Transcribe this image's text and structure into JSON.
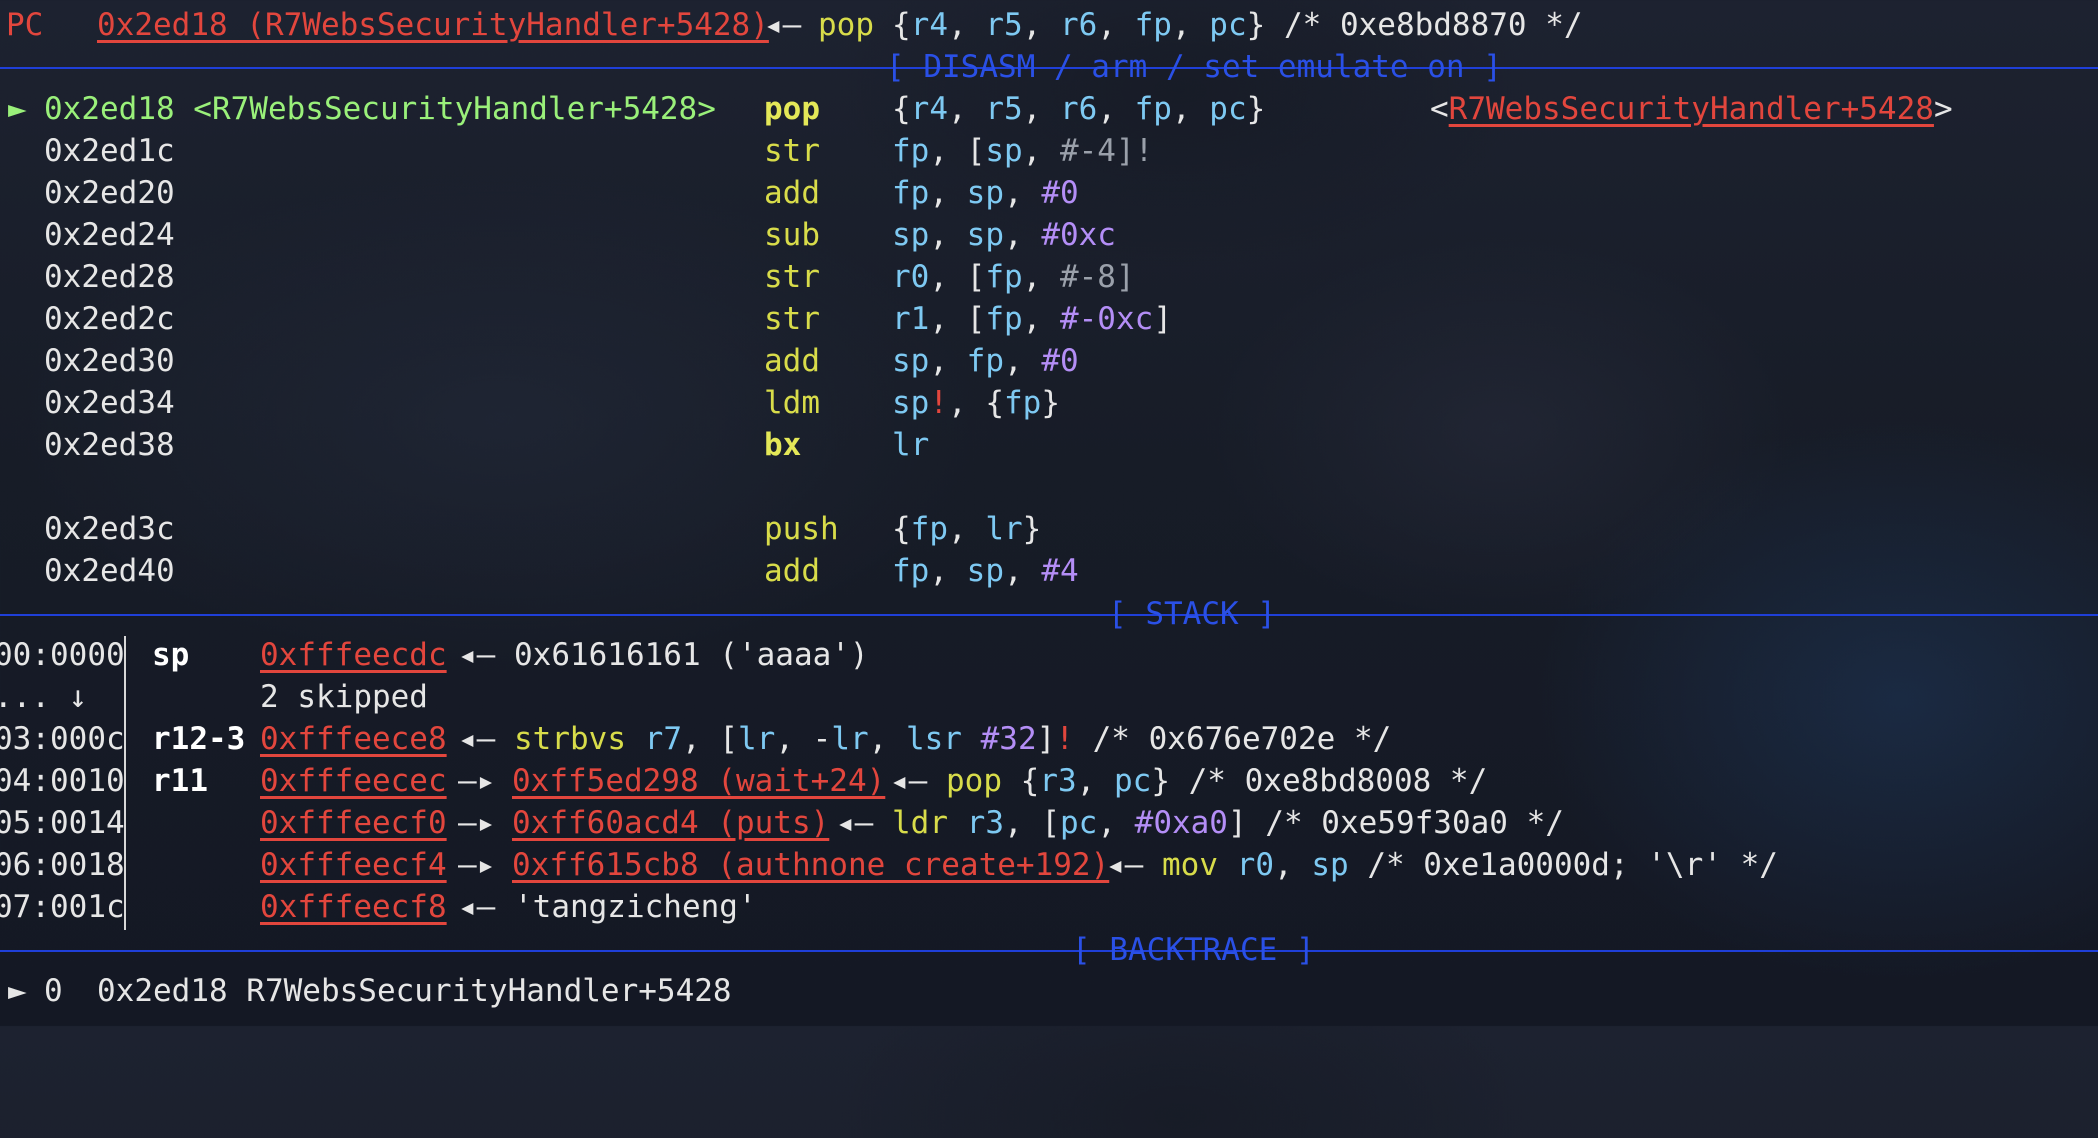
{
  "header": {
    "pc_label": "PC",
    "pc_value": "0x2ed18 (R7WebsSecurityHandler+5428)",
    "arrow": "◂—",
    "mnemonic": "pop",
    "operands": [
      "{",
      "r4",
      ", ",
      "r5",
      ", ",
      "r6",
      ", ",
      "fp",
      ", ",
      "pc",
      "}"
    ],
    "comment": " /* 0xe8bd8870 */"
  },
  "disasm": {
    "banner": "[ DISASM / arm / set emulate on ]",
    "current_marker": "►",
    "rows": [
      {
        "addr": "0x2ed18 <R7WebsSecurityHandler+5428>",
        "op": "pop",
        "args": "{r4, r5, r6, fp, pc}",
        "target": "R7WebsSecurityHandler+5428",
        "current": true
      },
      {
        "addr": "0x2ed1c",
        "op": "str",
        "args": "fp, [sp, #-4]!"
      },
      {
        "addr": "0x2ed20",
        "op": "add",
        "args": "fp, sp, #0"
      },
      {
        "addr": "0x2ed24",
        "op": "sub",
        "args": "sp, sp, #0xc"
      },
      {
        "addr": "0x2ed28",
        "op": "str",
        "args": "r0, [fp, #-8]"
      },
      {
        "addr": "0x2ed2c",
        "op": "str",
        "args": "r1, [fp, #-0xc]"
      },
      {
        "addr": "0x2ed30",
        "op": "add",
        "args": "sp, fp, #0"
      },
      {
        "addr": "0x2ed34",
        "op": "ldm",
        "args": "sp!, {fp}"
      },
      {
        "addr": "0x2ed38",
        "op": "bx",
        "args": "lr"
      },
      {
        "addr": "0x2ed3c",
        "op": "push",
        "args": "{fp, lr}"
      },
      {
        "addr": "0x2ed40",
        "op": "add",
        "args": "fp, sp, #4"
      }
    ]
  },
  "stack": {
    "banner": "[ STACK ]",
    "rows": [
      {
        "idx": "00:0000",
        "reg": "sp",
        "addr": "0xfffeecdc",
        "rest": "◂— 0x61616161 ('aaaa')"
      },
      {
        "idx": "... ↓",
        "reg": "",
        "addr": "",
        "rest": "2 skipped"
      },
      {
        "idx": "03:000c",
        "reg": "r12-3",
        "addr": "0xfffeece8",
        "rest": "◂— strbvs r7, [lr, -lr, lsr #32]! /* 0x676e702e */"
      },
      {
        "idx": "04:0010",
        "reg": "r11",
        "addr": "0xfffeecec",
        "link": "0xff5ed298 (wait+24)",
        "rest": "◂— pop {r3, pc} /* 0xe8bd8008 */"
      },
      {
        "idx": "05:0014",
        "reg": "",
        "addr": "0xfffeecf0",
        "link": "0xff60acd4 (puts)",
        "rest": "◂— ldr r3, [pc, #0xa0] /* 0xe59f30a0 */"
      },
      {
        "idx": "06:0018",
        "reg": "",
        "addr": "0xfffeecf4",
        "link": "0xff615cb8 (authnone_create+192)",
        "rest": "◂— mov r0, sp /* 0xe1a0000d; '\\r' */"
      },
      {
        "idx": "07:001c",
        "reg": "",
        "addr": "0xfffeecf8",
        "rest": "◂— 'tangzicheng'"
      }
    ]
  },
  "backtrace": {
    "banner": "[ BACKTRACE ]",
    "marker": "►",
    "frame": "0",
    "entry": "0x2ed18 R7WebsSecurityHandler+5428"
  },
  "colors": {
    "address_red": "#e2463d",
    "current_green": "#9af07a",
    "mnemonic_yellow": "#d8dc4a",
    "register_cyan": "#7ec9f2",
    "immediate_purple": "#b48ef6",
    "banner_blue": "#2a50e6"
  }
}
